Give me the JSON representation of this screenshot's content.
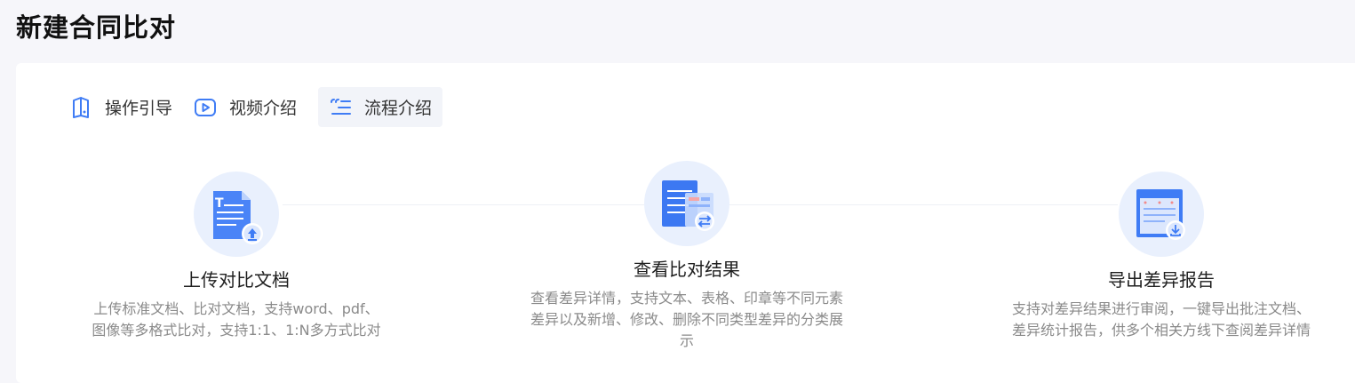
{
  "page": {
    "title": "新建合同比对"
  },
  "tabs": [
    {
      "label": "操作引导",
      "icon": "guide-icon",
      "active": false
    },
    {
      "label": "视频介绍",
      "icon": "play-video-icon",
      "active": false
    },
    {
      "label": "流程介绍",
      "icon": "process-list-icon",
      "active": true
    }
  ],
  "steps": [
    {
      "title": "上传对比文档",
      "desc_lines": [
        "上传标准文档、比对文档，支持word、pdf、",
        "图像等多格式比对，支持1:1、1:N多方式比对"
      ],
      "icon": "upload-document-icon"
    },
    {
      "title": "查看比对结果",
      "desc_lines": [
        "查看差异详情，支持文本、表格、印章等不同元素",
        "差异以及新增、修改、删除不同类型差异的分类展",
        "示"
      ],
      "icon": "compare-result-icon"
    },
    {
      "title": "导出差异报告",
      "desc_lines": [
        "支持对差异结果进行审阅，一键导出批注文档、",
        "差异统计报告，供多个相关方线下查阅差异详情"
      ],
      "icon": "export-report-icon"
    }
  ],
  "colors": {
    "accent": "#3f7cf5",
    "tab_active_bg": "#f2f4f9",
    "circle_bg": "#e9f0fd",
    "desc_text": "#8a8a8a"
  }
}
